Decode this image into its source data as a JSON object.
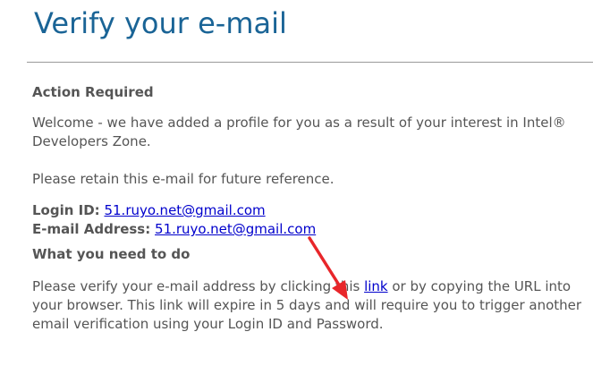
{
  "page_title": "Verify your e-mail",
  "section_action": {
    "heading": "Action Required",
    "welcome_text": "Welcome - we have added a profile for you as a result of your interest in Intel® Developers Zone.",
    "retain_text": "Please retain this e-mail for future reference."
  },
  "account": {
    "login_label": "Login ID:",
    "login_value": "51.ruyo.net@gmail.com",
    "email_label": "E-mail Address:",
    "email_value": "51.ruyo.net@gmail.com"
  },
  "section_todo": {
    "heading": "What you need to do",
    "text_before_link": "Please verify your e-mail address by clicking this ",
    "link_text": "link",
    "text_after_link": " or by copying the URL into your browser. This link will expire in 5 days and will require you to trigger another email verification using your Login ID and Password."
  },
  "colors": {
    "title": "#1a6496",
    "body_text": "#555555",
    "link": "#0000cc",
    "annotation_arrow": "#e8262a"
  },
  "annotation": {
    "icon": "red-arrow-icon"
  }
}
